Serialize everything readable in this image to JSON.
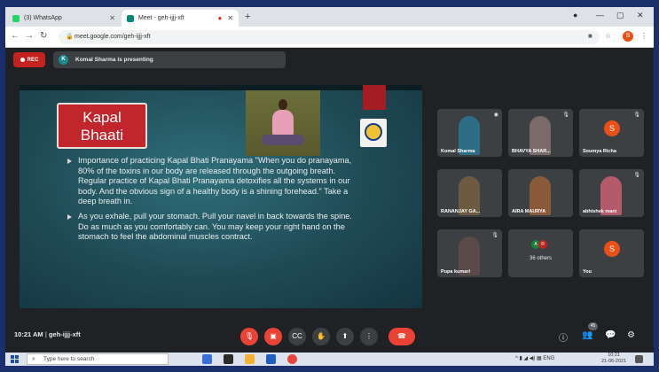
{
  "browser": {
    "tabs": [
      {
        "label": "(3) WhatsApp",
        "active": false,
        "favicon_color": "#25d366"
      },
      {
        "label": "Meet - geh-ijjj-xft",
        "active": true,
        "favicon_color": "#00897b"
      }
    ],
    "url": "meet.google.com/geh-ijjj-xft",
    "profile_initial": "S"
  },
  "meet": {
    "rec_label": "REC",
    "presenter_initial": "K",
    "presenting_text": "Komal Sharma is presenting",
    "meeting_time": "10:21 AM",
    "meeting_code": "geh-ijjj-xft",
    "people_count": "45"
  },
  "slide": {
    "title_line1": "Kapal",
    "title_line2": "Bhaati",
    "bullet1": "Importance of practicing Kapal Bhati Pranayama \"When you do pranayama, 80% of the toxins in our body are released through the outgoing breath. Regular practice of Kapal Bhati Pranayama detoxifies all the systems in our body. And the obvious sign of a healthy body is a shining forehead.\" Take a deep breath in.",
    "bullet2": "As you exhale, pull your stomach. Pull your navel in back towards the spine. Do as much as you comfortably can. You may keep your right hand on the stomach to feel the abdominal muscles contract."
  },
  "participants": [
    {
      "name": "Komal Sharma",
      "kind": "video",
      "color": "#2d6e86"
    },
    {
      "name": "BHAVYA SHAR...",
      "kind": "video",
      "color": "#7a6a6a"
    },
    {
      "name": "Soumya Richa",
      "kind": "avatar",
      "initial": "S"
    },
    {
      "name": "RANANJAY GA...",
      "kind": "video",
      "color": "#6e5a40"
    },
    {
      "name": "AIRA MAURYA",
      "kind": "video",
      "color": "#8a5a3a"
    },
    {
      "name": "abhishek mani",
      "kind": "video",
      "color": "#b45a6a"
    },
    {
      "name": "Pupa kumari",
      "kind": "video",
      "color": "#5a4a4a"
    },
    {
      "name": "36 others",
      "kind": "others",
      "initials": [
        "A",
        "R"
      ]
    },
    {
      "name": "You",
      "kind": "avatar",
      "initial": "S"
    }
  ],
  "taskbar": {
    "search_placeholder": "Type here to search",
    "tray": "ENG",
    "time": "10:21",
    "date": "21-06-2021"
  }
}
